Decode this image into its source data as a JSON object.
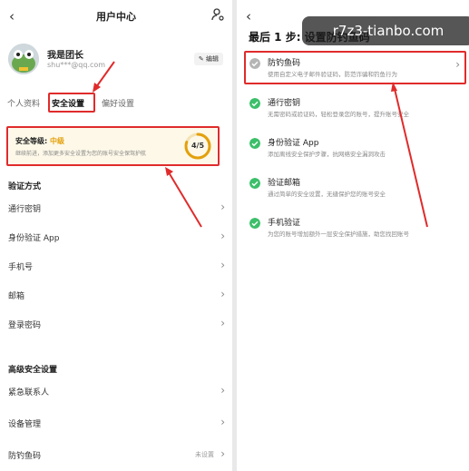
{
  "left": {
    "header": {
      "title": "用户中心"
    },
    "profile": {
      "name": "我是团长",
      "email": "shu***@qq.com",
      "edit_label": "编辑"
    },
    "tabs": [
      "个人资料",
      "安全设置",
      "偏好设置"
    ],
    "security": {
      "label": "安全等级: ",
      "level": "中级",
      "desc": "继续前进，添加更多安全设置为您的账号安全保驾护航",
      "score": "4/5",
      "progress": 0.8
    },
    "verify_section": "验证方式",
    "verify_items": [
      "通行密钥",
      "身份验证 App",
      "手机号",
      "邮箱",
      "登录密码"
    ],
    "advanced_section": "高级安全设置",
    "advanced_items": [
      {
        "label": "紧急联系人",
        "value": ""
      },
      {
        "label": "设备管理",
        "value": ""
      },
      {
        "label": "防钓鱼码",
        "value": "未设置"
      }
    ]
  },
  "right": {
    "title": "最后 1 步: 设置防钓鱼码",
    "watermark": "r7z3-tianbo.com",
    "steps": [
      {
        "title": "防钓鱼码",
        "desc": "使用自定义电子邮件验证码，防范诈骗和钓鱼行为",
        "status": "pending"
      },
      {
        "title": "通行密钥",
        "desc": "无需密码或验证码，轻松登录您的账号，提升账号安全",
        "status": "done"
      },
      {
        "title": "身份验证 App",
        "desc": "添加离线安全保护步骤，抗网络安全漏洞攻击",
        "status": "done"
      },
      {
        "title": "验证邮箱",
        "desc": "通过简单的安全设置，无缝保护您的账号安全",
        "status": "done"
      },
      {
        "title": "手机验证",
        "desc": "为您的账号增加额外一层安全保护措施，助您找回账号",
        "status": "done"
      }
    ]
  },
  "colors": {
    "accent_red": "#e02b2b",
    "done_green": "#3cbf6a",
    "pending_gray": "#b5b5b5",
    "level_orange": "#e3a00b"
  }
}
